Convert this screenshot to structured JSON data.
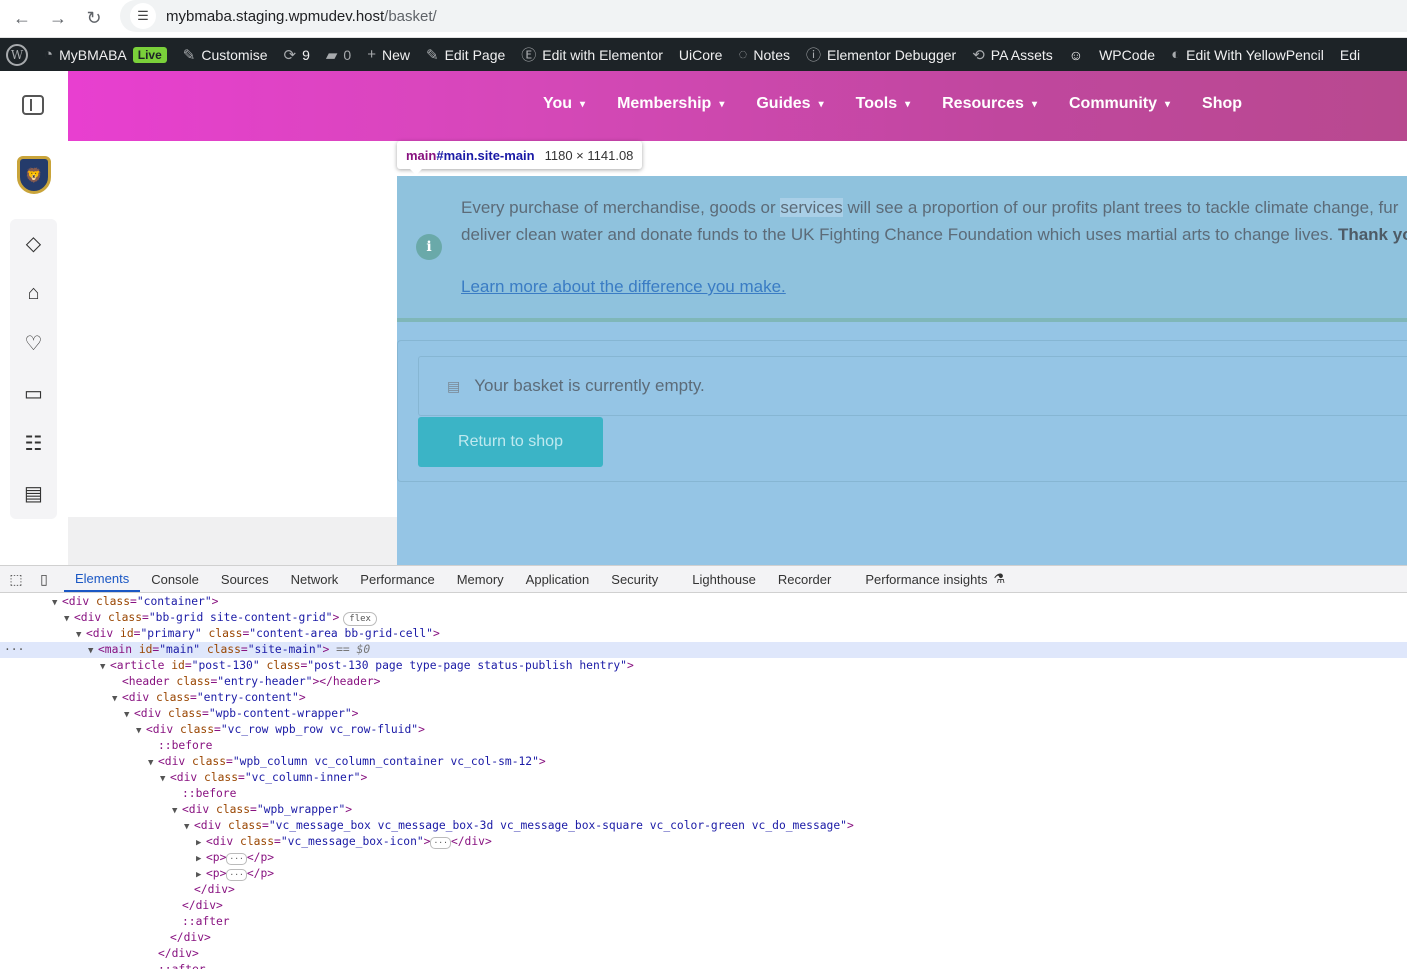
{
  "browser": {
    "url_host": "mybmaba.staging.wpmudev.host",
    "url_path": "/basket/"
  },
  "admin_bar": {
    "site_name": "MyBMABA",
    "live_badge": "Live",
    "customise": "Customise",
    "updates_count": "9",
    "comments_count": "0",
    "new": "New",
    "edit_page": "Edit Page",
    "edit_elementor": "Edit with Elementor",
    "uicore": "UiCore",
    "notes": "Notes",
    "elementor_debugger": "Elementor Debugger",
    "pa_assets": "PA Assets",
    "wpcode": "WPCode",
    "yellowpencil": "Edit With YellowPencil",
    "overflow": "Edi"
  },
  "site_menu": [
    {
      "label": "You",
      "has_dropdown": true
    },
    {
      "label": "Membership",
      "has_dropdown": true
    },
    {
      "label": "Guides",
      "has_dropdown": true
    },
    {
      "label": "Tools",
      "has_dropdown": true
    },
    {
      "label": "Resources",
      "has_dropdown": true
    },
    {
      "label": "Community",
      "has_dropdown": true
    },
    {
      "label": "Shop",
      "has_dropdown": false
    }
  ],
  "inspect_tooltip": {
    "tag": "main",
    "selector": "#main.site-main",
    "size": "1180 × 1141.08"
  },
  "message": {
    "line1_pre": "Every purchase of merchandise, goods or ",
    "line1_hl": "services",
    "line1_post": " will see a proportion of our profits plant trees to tackle climate change, fur",
    "line2_pre": "deliver clean water and donate funds to the UK Fighting Chance Foundation which uses martial arts to change lives. ",
    "line2_bold": "Thank yo",
    "link": "Learn more about the difference you make."
  },
  "basket": {
    "empty_text": "Your basket is currently empty.",
    "return_button": "Return to shop"
  },
  "devtools": {
    "tabs": [
      "Elements",
      "Console",
      "Sources",
      "Network",
      "Performance",
      "Memory",
      "Application",
      "Security",
      "Lighthouse",
      "Recorder",
      "Performance insights"
    ],
    "active_tab": "Elements",
    "selected_suffix": " == $0",
    "flex_badge": "flex"
  },
  "colors": {
    "admin_bar": "#1d2327",
    "header_gradient_start": "#e83fd0",
    "header_gradient_end": "#b8498f",
    "highlight_overlay": "#95c5e5",
    "button": "#3bb4c6",
    "devtools_accent": "#1a57c4"
  }
}
